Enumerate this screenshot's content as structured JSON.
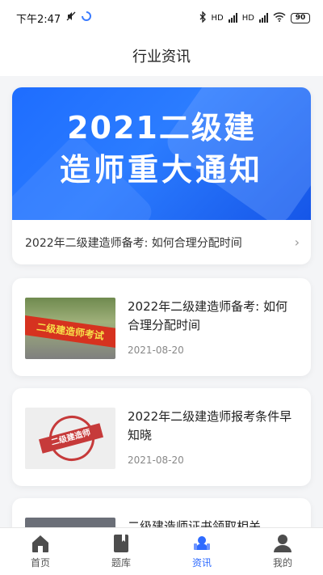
{
  "status_bar": {
    "time": "下午2:47",
    "battery": "90",
    "network_tags": "HD"
  },
  "header": {
    "title": "行业资讯"
  },
  "featured": {
    "banner_line1": "2021二级建",
    "banner_line2": "造师重大通知",
    "caption": "2022年二级建造师备考: 如何合理分配时间"
  },
  "news": [
    {
      "title": "2022年二级建造师备考: 如何合理分配时间",
      "date": "2021-08-20",
      "thumb_text": "二级建造师考试"
    },
    {
      "title": "2022年二级建造师报考条件早知晓",
      "date": "2021-08-20",
      "thumb_text": "二级建造师"
    },
    {
      "title": "二级建造师证书领取相关"
    }
  ],
  "tabs": [
    {
      "label": "首页",
      "icon": "home-icon",
      "active": false
    },
    {
      "label": "题库",
      "icon": "book-icon",
      "active": false
    },
    {
      "label": "资讯",
      "icon": "news-icon",
      "active": true
    },
    {
      "label": "我的",
      "icon": "profile-icon",
      "active": false
    }
  ],
  "colors": {
    "accent": "#2f6bff",
    "banner_blue": "#1e6dff",
    "background": "#f4f5f7"
  }
}
